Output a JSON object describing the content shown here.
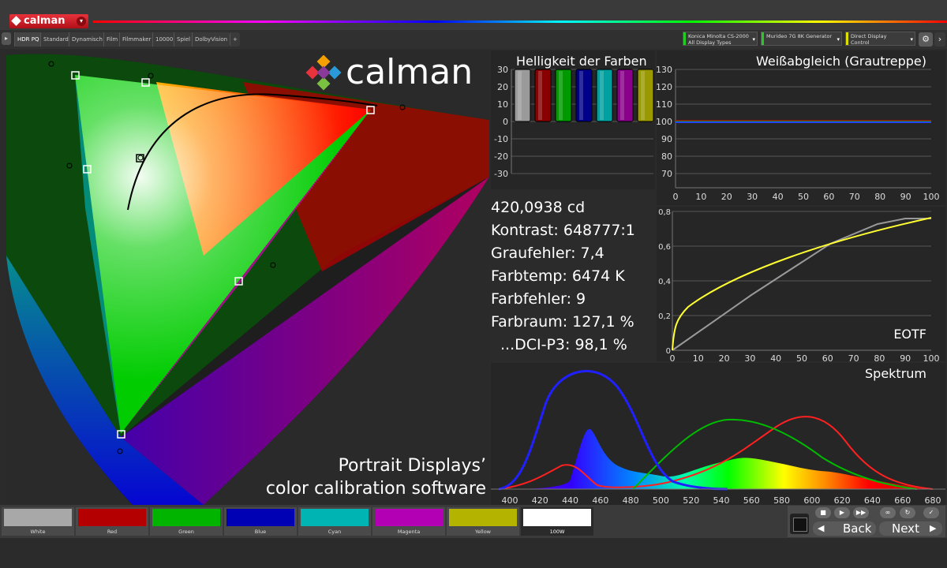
{
  "app": {
    "name": "calman"
  },
  "tabs": [
    "HDR PQ",
    "Standard",
    "Dynamisch",
    "Film",
    "Filmmaker",
    "10000",
    "Spiel",
    "DolbyVision",
    "+"
  ],
  "devices": [
    {
      "line1": "Konica Minolta CS-2000",
      "line2": "All Display Types",
      "color": "#22cc22"
    },
    {
      "line1": "Murideo 7G 8K Generator",
      "line2": "",
      "color": "#22cc22"
    },
    {
      "line1": "Direct Display Control",
      "line2": "",
      "color": "#dddd00"
    }
  ],
  "cie": {
    "overlay_line1": "Portrait Displays’",
    "overlay_line2": "color calibration software"
  },
  "brightness_chart": {
    "title": "Helligkeit der Farben",
    "y_ticks": [
      "30",
      "20",
      "10",
      "0",
      "-10",
      "-20",
      "-30"
    ],
    "bars": [
      {
        "name": "White",
        "color": "#9a9a9a",
        "value": 30
      },
      {
        "name": "Red",
        "color": "#8a0000",
        "value": 30
      },
      {
        "name": "Green",
        "color": "#009a00",
        "value": 30
      },
      {
        "name": "Blue",
        "color": "#00008a",
        "value": 30
      },
      {
        "name": "Cyan",
        "color": "#00a0a0",
        "value": 30
      },
      {
        "name": "Magenta",
        "color": "#8a008a",
        "value": 30
      },
      {
        "name": "Yellow",
        "color": "#9a9a00",
        "value": 30
      }
    ]
  },
  "grayscale_chart": {
    "title": "Weißabgleich (Grautreppe)",
    "y_ticks": [
      "130",
      "120",
      "110",
      "100",
      "90",
      "80",
      "70"
    ],
    "x_ticks": [
      "0",
      "10",
      "20",
      "30",
      "40",
      "50",
      "60",
      "70",
      "80",
      "90",
      "100"
    ]
  },
  "eotf_chart": {
    "title": "EOTF",
    "y_ticks": [
      "0,8",
      "0,6",
      "0,4",
      "0,2",
      "0"
    ],
    "x_ticks": [
      "0",
      "10",
      "20",
      "30",
      "40",
      "50",
      "60",
      "70",
      "80",
      "90",
      "100"
    ]
  },
  "spectrum_chart": {
    "title": "Spektrum",
    "x_ticks": [
      "400",
      "420",
      "440",
      "460",
      "480",
      "500",
      "520",
      "540",
      "560",
      "580",
      "600",
      "620",
      "640",
      "660",
      "680"
    ]
  },
  "stats": {
    "luminance": "420,0938 cd",
    "contrast": "Kontrast: 648777:1",
    "gray_error": "Graufehler: 7,4",
    "color_temp": "Farbtemp: 6474 K",
    "color_error": "Farbfehler: 9",
    "gamut": "Farbraum: 127,1 %",
    "dci_p3": "...DCI-P3: 98,1 %"
  },
  "swatches": [
    {
      "label": "White",
      "color": "#a8a8a8"
    },
    {
      "label": "Red",
      "color": "#b40000"
    },
    {
      "label": "Green",
      "color": "#00b400"
    },
    {
      "label": "Blue",
      "color": "#0000b4"
    },
    {
      "label": "Cyan",
      "color": "#00b4b4"
    },
    {
      "label": "Magenta",
      "color": "#b400b4"
    },
    {
      "label": "Yellow",
      "color": "#b4b400"
    },
    {
      "label": "100W",
      "color": "#ffffff"
    }
  ],
  "nav": {
    "back": "Back",
    "next": "Next"
  }
}
